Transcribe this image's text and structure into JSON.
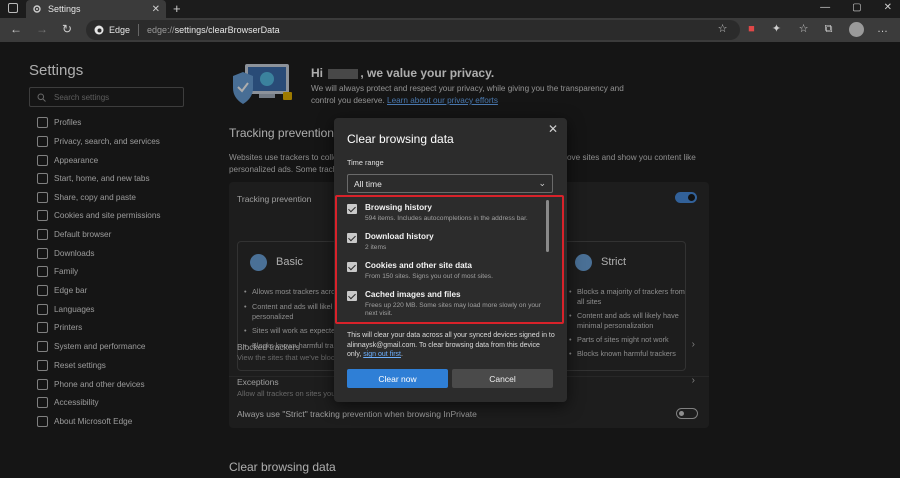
{
  "window": {
    "tab_title": "Settings"
  },
  "address": {
    "host": "Edge",
    "url_base": "edge://",
    "url_path": "settings/clearBrowserData"
  },
  "sidebar": {
    "title": "Settings",
    "search_placeholder": "Search settings",
    "items": [
      {
        "label": "Profiles"
      },
      {
        "label": "Privacy, search, and services"
      },
      {
        "label": "Appearance"
      },
      {
        "label": "Start, home, and new tabs"
      },
      {
        "label": "Share, copy and paste"
      },
      {
        "label": "Cookies and site permissions"
      },
      {
        "label": "Default browser"
      },
      {
        "label": "Downloads"
      },
      {
        "label": "Family"
      },
      {
        "label": "Edge bar"
      },
      {
        "label": "Languages"
      },
      {
        "label": "Printers"
      },
      {
        "label": "System and performance"
      },
      {
        "label": "Reset settings"
      },
      {
        "label": "Phone and other devices"
      },
      {
        "label": "Accessibility"
      },
      {
        "label": "About Microsoft Edge"
      }
    ]
  },
  "main": {
    "greeting_prefix": "Hi",
    "greeting_suffix": ", we value your privacy.",
    "hero_text": "We will always protect and respect your privacy, while giving you the transparency and control you deserve.",
    "hero_link": "Learn about our privacy efforts",
    "tracking_heading": "Tracking prevention",
    "tracking_para_left": "Websites use trackers to colle",
    "tracking_para_right": "ove sites and show you content like",
    "tracking_para_line2": "personalized ads. Some track",
    "card": {
      "title": "Tracking prevention",
      "basic": {
        "title": "Basic",
        "bullets": [
          "Allows most trackers acro",
          "Content and ads will likel personalized",
          "Sites will work as expecte",
          "Blocks known harmful tra"
        ]
      },
      "strict": {
        "title": "Strict",
        "bullets": [
          "Blocks a majority of trackers from all sites",
          "Content and ads will likely have minimal personalization",
          "Parts of sites might not work",
          "Blocks known harmful trackers"
        ]
      },
      "blocked_title": "Blocked trackers",
      "blocked_sub": "View the sites that we've block",
      "exceptions_title": "Exceptions",
      "exceptions_sub": "Allow all trackers on sites you c",
      "inprivate_label": "Always use \"Strict\" tracking prevention when browsing InPrivate"
    },
    "clear_heading": "Clear browsing data"
  },
  "dialog": {
    "title": "Clear browsing data",
    "time_range_label": "Time range",
    "time_range_value": "All time",
    "items": [
      {
        "title": "Browsing history",
        "desc": "594 items. Includes autocompletions in the address bar.",
        "checked": true
      },
      {
        "title": "Download history",
        "desc": "2 items",
        "checked": true
      },
      {
        "title": "Cookies and other site data",
        "desc": "From 150 sites. Signs you out of most sites.",
        "checked": true
      },
      {
        "title": "Cached images and files",
        "desc": "Frees up 220 MB. Some sites may load more slowly on your next visit.",
        "checked": true
      }
    ],
    "note": "This will clear your data across all your synced devices signed in to alinnaysk@gmail.com. To clear browsing data from this device only,",
    "note_link": "sign out first",
    "note_end": ".",
    "clear_button": "Clear now",
    "cancel_button": "Cancel"
  },
  "colors": {
    "accent": "#2f7fd6",
    "highlight": "#d8222a",
    "link": "#6cb0ff"
  }
}
